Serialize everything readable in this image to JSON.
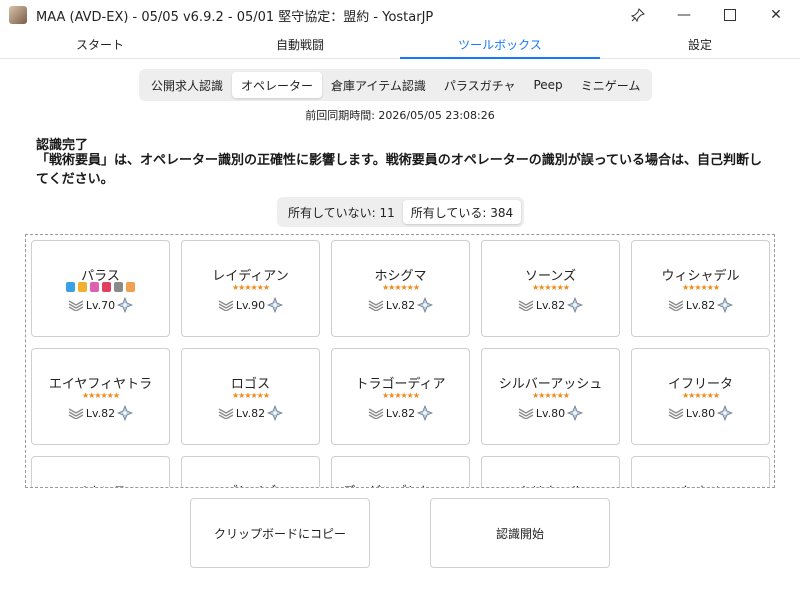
{
  "window": {
    "title": "MAA (AVD-EX) - 05/05 v6.9.2 - 05/01 堅守協定：盟約 - YostarJP",
    "pin_icon": "pin-icon",
    "minimize_icon": "minimize-icon",
    "maximize_icon": "maximize-icon",
    "close_icon": "close-icon",
    "minimize_glyph": "—",
    "close_glyph": "✕"
  },
  "main_tabs": [
    {
      "label": "スタート",
      "active": false
    },
    {
      "label": "自動戦闘",
      "active": false
    },
    {
      "label": "ツールボックス",
      "active": true
    },
    {
      "label": "設定",
      "active": false
    }
  ],
  "sub_tabs": [
    {
      "label": "公開求人認識",
      "active": false
    },
    {
      "label": "オペレーター",
      "active": true
    },
    {
      "label": "倉庫アイテム認識",
      "active": false
    },
    {
      "label": "パラスガチャ",
      "active": false
    },
    {
      "label": "Peep",
      "active": false
    },
    {
      "label": "ミニゲーム",
      "active": false
    }
  ],
  "sync_time": "前回同期時間: 2026/05/05 23:08:26",
  "status": {
    "title": "認識完了",
    "message": "「戦術要員」は、オペレーター識別の正確性に影響します。戦術要員のオペレーターの識別が誤っている場合は、自己判断してください。"
  },
  "filter": {
    "not_owned": "所有していない: 11",
    "owned": "所有している: 384"
  },
  "operators": [
    {
      "name": "パラス",
      "stars": "",
      "modules": [
        "#3aa0e8",
        "#f0b030",
        "#e060b0",
        "#e04060",
        "#8a8a8a",
        "#f0a050"
      ],
      "level": "Lv.70",
      "rank_icon": "elite-2-icon",
      "potential_icon": "potential-icon"
    },
    {
      "name": "レイディアン",
      "stars": "★★★★★★",
      "modules": [],
      "level": "Lv.90",
      "rank_icon": "elite-2-icon",
      "potential_icon": "potential-icon"
    },
    {
      "name": "ホシグマ",
      "stars": "★★★★★★",
      "modules": [],
      "level": "Lv.82",
      "rank_icon": "elite-2-icon",
      "potential_icon": "potential-icon"
    },
    {
      "name": "ソーンズ",
      "stars": "★★★★★★",
      "modules": [],
      "level": "Lv.82",
      "rank_icon": "elite-2-icon",
      "potential_icon": "potential-icon"
    },
    {
      "name": "ウィシャデル",
      "stars": "★★★★★★",
      "modules": [],
      "level": "Lv.82",
      "rank_icon": "elite-2-icon",
      "potential_icon": "potential-icon"
    },
    {
      "name": "エイヤフィヤトラ",
      "stars": "★★★★★★",
      "modules": [],
      "level": "Lv.82",
      "rank_icon": "elite-2-icon",
      "potential_icon": "potential-icon"
    },
    {
      "name": "ロゴス",
      "stars": "★★★★★★",
      "modules": [],
      "level": "Lv.82",
      "rank_icon": "elite-2-icon",
      "potential_icon": "potential-icon"
    },
    {
      "name": "トラゴーディア",
      "stars": "★★★★★★",
      "modules": [],
      "level": "Lv.82",
      "rank_icon": "elite-2-icon",
      "potential_icon": "potential-icon"
    },
    {
      "name": "シルバーアッシュ",
      "stars": "★★★★★★",
      "modules": [],
      "level": "Lv.80",
      "rank_icon": "elite-2-icon",
      "potential_icon": "potential-icon"
    },
    {
      "name": "イフリータ",
      "stars": "★★★★★★",
      "modules": [],
      "level": "Lv.80",
      "rank_icon": "elite-2-icon",
      "potential_icon": "potential-icon"
    },
    {
      "name": "ペナンス",
      "stars": "★★★★★★",
      "modules": [],
      "level": "",
      "rank_icon": "elite-2-icon",
      "potential_icon": "potential-icon"
    },
    {
      "name": "ブレイズ",
      "stars": "★★★★★★",
      "modules": [],
      "level": "",
      "rank_icon": "elite-2-icon",
      "potential_icon": "potential-icon"
    },
    {
      "name": "デーゲンブレヒャー",
      "stars": "★★★★★★",
      "modules": [],
      "level": "",
      "rank_icon": "elite-2-icon",
      "potential_icon": "potential-icon"
    },
    {
      "name": "ムリナール",
      "stars": "★★★★★★",
      "modules": [],
      "level": "",
      "rank_icon": "elite-2-icon",
      "potential_icon": "potential-icon"
    },
    {
      "name": "ケオベ",
      "stars": "★★★★★★",
      "modules": [],
      "level": "",
      "rank_icon": "elite-2-icon",
      "potential_icon": "potential-icon"
    }
  ],
  "buttons": {
    "copy": "クリップボードにコピー",
    "start": "認識開始"
  },
  "colors": {
    "accent": "#1677ff",
    "star": "#f08a1a"
  }
}
